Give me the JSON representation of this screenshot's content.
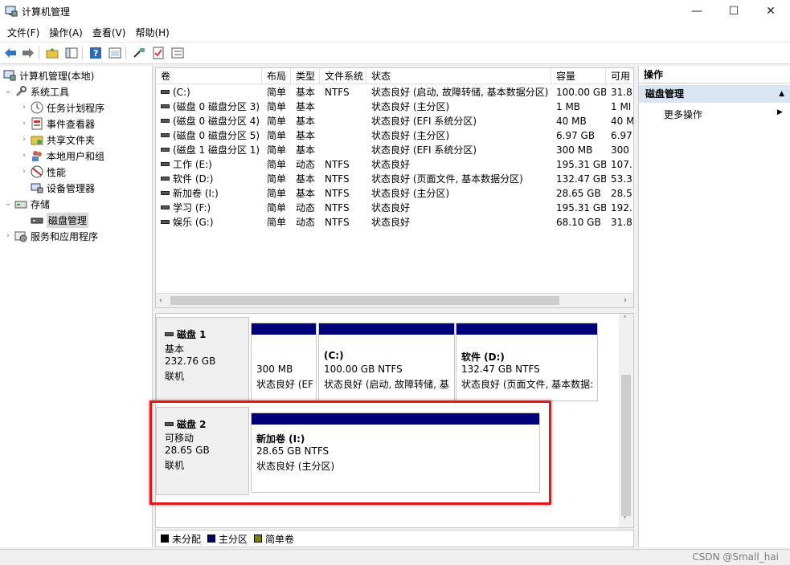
{
  "window": {
    "title": "计算机管理",
    "controls": {
      "minimize": "—",
      "maximize": "☐",
      "close": "✕"
    }
  },
  "menu": [
    "文件(F)",
    "操作(A)",
    "查看(V)",
    "帮助(H)"
  ],
  "tree": {
    "root": "计算机管理(本地)",
    "system_tools": "系统工具",
    "task_scheduler": "任务计划程序",
    "event_viewer": "事件查看器",
    "shared_folders": "共享文件夹",
    "local_users": "本地用户和组",
    "performance": "性能",
    "device_manager": "设备管理器",
    "storage": "存储",
    "disk_management": "磁盘管理",
    "services_apps": "服务和应用程序"
  },
  "columns": [
    "卷",
    "布局",
    "类型",
    "文件系统",
    "状态",
    "容量",
    "可用"
  ],
  "volumes": [
    {
      "name": "(C:)",
      "layout": "简单",
      "type": "基本",
      "fs": "NTFS",
      "status": "状态良好 (启动, 故障转储, 基本数据分区)",
      "capacity": "100.00 GB",
      "free": "31.8"
    },
    {
      "name": "(磁盘 0 磁盘分区 3)",
      "layout": "简单",
      "type": "基本",
      "fs": "",
      "status": "状态良好 (主分区)",
      "capacity": "1 MB",
      "free": "1 MI"
    },
    {
      "name": "(磁盘 0 磁盘分区 4)",
      "layout": "简单",
      "type": "基本",
      "fs": "",
      "status": "状态良好 (EFI 系统分区)",
      "capacity": "40 MB",
      "free": "40 M"
    },
    {
      "name": "(磁盘 0 磁盘分区 5)",
      "layout": "简单",
      "type": "基本",
      "fs": "",
      "status": "状态良好 (主分区)",
      "capacity": "6.97 GB",
      "free": "6.97"
    },
    {
      "name": "(磁盘 1 磁盘分区 1)",
      "layout": "简单",
      "type": "基本",
      "fs": "",
      "status": "状态良好 (EFI 系统分区)",
      "capacity": "300 MB",
      "free": "300"
    },
    {
      "name": "工作 (E:)",
      "layout": "简单",
      "type": "动态",
      "fs": "NTFS",
      "status": "状态良好",
      "capacity": "195.31 GB",
      "free": "107."
    },
    {
      "name": "软件 (D:)",
      "layout": "简单",
      "type": "基本",
      "fs": "NTFS",
      "status": "状态良好 (页面文件, 基本数据分区)",
      "capacity": "132.47 GB",
      "free": "53.3"
    },
    {
      "name": "新加卷 (I:)",
      "layout": "简单",
      "type": "基本",
      "fs": "NTFS",
      "status": "状态良好 (主分区)",
      "capacity": "28.65 GB",
      "free": "28.5"
    },
    {
      "name": "学习 (F:)",
      "layout": "简单",
      "type": "动态",
      "fs": "NTFS",
      "status": "状态良好",
      "capacity": "195.31 GB",
      "free": "192."
    },
    {
      "name": "娱乐 (G:)",
      "layout": "简单",
      "type": "动态",
      "fs": "NTFS",
      "status": "状态良好",
      "capacity": "68.10 GB",
      "free": "31.8"
    }
  ],
  "disks": {
    "disk1": {
      "name": "磁盘 1",
      "type": "基本",
      "size": "232.76 GB",
      "state": "联机",
      "p1": {
        "size": "300 MB",
        "status": "状态良好 (EF"
      },
      "p2": {
        "label": "(C:)",
        "size": "100.00 GB NTFS",
        "status": "状态良好 (启动, 故障转储, 基"
      },
      "p3": {
        "label": "软件 (D:)",
        "size": "132.47 GB NTFS",
        "status": "状态良好 (页面文件, 基本数据:"
      }
    },
    "disk2": {
      "name": "磁盘 2",
      "type": "可移动",
      "size": "28.65 GB",
      "state": "联机",
      "p1": {
        "label": "新加卷 (I:)",
        "size": "28.65 GB NTFS",
        "status": "状态良好 (主分区)"
      }
    }
  },
  "legend": {
    "unallocated": "未分配",
    "primary": "主分区",
    "simple": "简单卷"
  },
  "colors": {
    "primary": "#00007b",
    "unallocated": "#000000",
    "simple": "#808000",
    "highlight": "#e21919"
  },
  "actions": {
    "header": "操作",
    "section": "磁盘管理",
    "more": "更多操作"
  },
  "watermark": "CSDN @Small_hai"
}
